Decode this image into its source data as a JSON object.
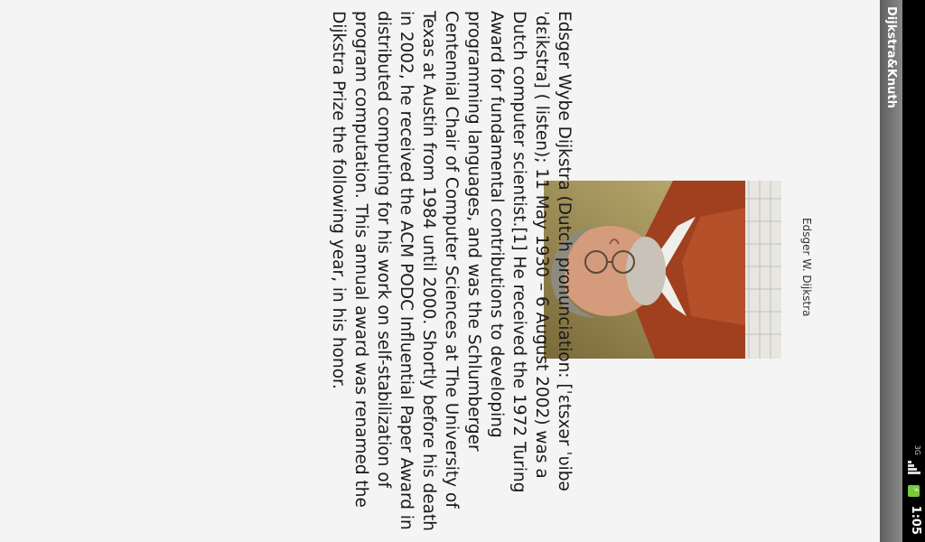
{
  "status_bar": {
    "time": "1:05",
    "network_label": "3G",
    "icons": [
      "network-3g-icon",
      "signal-icon",
      "battery-charging-icon"
    ]
  },
  "title_bar": {
    "title": "Dijkstra&Knuth"
  },
  "article": {
    "image_caption": "Edsger W. Dijkstra",
    "image_alt": "Edsger W. Dijkstra portrait photo",
    "body": "Edsger Wybe Dijkstra (Dutch pronunciation: [ˈɛtsxər ˈʋibə ˈdɛikstra] ( listen); 11 May 1930 – 6 August 2002) was a Dutch computer scientist.[1] He received the 1972 Turing Award for fundamental contributions to developing programming languages, and was the Schlumberger Centennial Chair of Computer Sciences at The University of Texas at Austin from 1984 until 2000. Shortly before his death in 2002, he received the ACM PODC Influential Paper Award in distributed computing for his work on self-stabilization of program computation. This annual award was renamed the Dijkstra Prize the following year, in his honor."
  },
  "colors": {
    "status_bar_bg": "#000000",
    "title_bar_bg": "#6e6e6e",
    "content_bg": "#f4f4f4",
    "battery": "#79c83a"
  }
}
